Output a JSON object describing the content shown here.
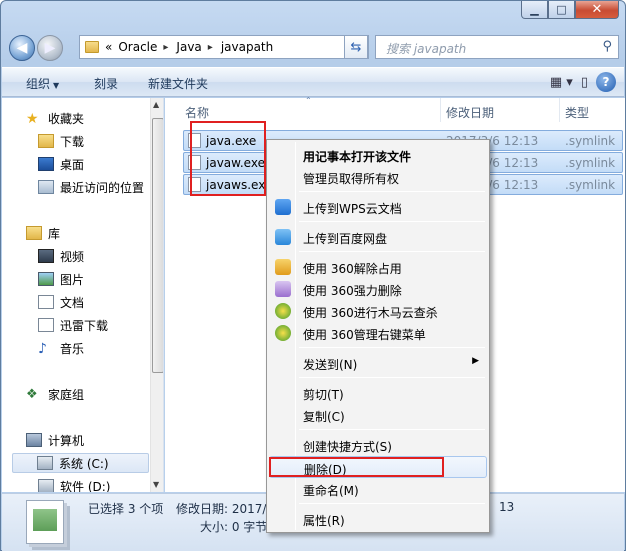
{
  "window": {
    "caption": {
      "min": "▁",
      "max": "□",
      "close": "✕"
    }
  },
  "address": {
    "prefix": "«",
    "crumbs": [
      "Oracle",
      "Java",
      "javapath"
    ],
    "separator": "▸"
  },
  "search": {
    "placeholder": "搜索 javapath"
  },
  "toolbar": {
    "organize": "组织",
    "burn": "刻录",
    "new_folder": "新建文件夹"
  },
  "nav": {
    "favorites": "收藏夹",
    "downloads": "下载",
    "desktop": "桌面",
    "recent": "最近访问的位置",
    "libraries": "库",
    "videos": "视频",
    "pictures": "图片",
    "documents": "文档",
    "xunlei": "迅雷下载",
    "music": "音乐",
    "homegroup": "家庭组",
    "computer": "计算机",
    "system_c": "系统 (C:)",
    "software_d": "软件 (D:)"
  },
  "columns": {
    "name": "名称",
    "date": "修改日期",
    "type": "类型"
  },
  "files": [
    {
      "name": "java.exe",
      "date": "2017/3/6 12:13",
      "type": ".symlink"
    },
    {
      "name": "javaw.exe",
      "date": "2017/3/6 12:13",
      "type": ".symlink"
    },
    {
      "name": "javaws.exe",
      "date": "2017/3/6 12:13",
      "type": ".symlink"
    }
  ],
  "status": {
    "selected": "已选择 3 个项",
    "modified_label": "修改日期: 2017/",
    "size_label": "大小: 0 字节",
    "time_tail": "13"
  },
  "context_menu": {
    "open_notepad": "用记事本打开该文件",
    "take_ownership": "管理员取得所有权",
    "upload_wps": "上传到WPS云文档",
    "upload_baidu": "上传到百度网盘",
    "unlock_360": "使用 360解除占用",
    "force_delete_360": "使用 360强力删除",
    "scan_360": "使用 360进行木马云查杀",
    "manage_menu_360": "使用 360管理右键菜单",
    "send_to": "发送到(N)",
    "cut": "剪切(T)",
    "copy": "复制(C)",
    "create_shortcut": "创建快捷方式(S)",
    "delete": "删除(D)",
    "rename": "重命名(M)",
    "properties": "属性(R)"
  },
  "colors": {
    "highlight": "#e02020",
    "selection": "#c3dcf7"
  }
}
